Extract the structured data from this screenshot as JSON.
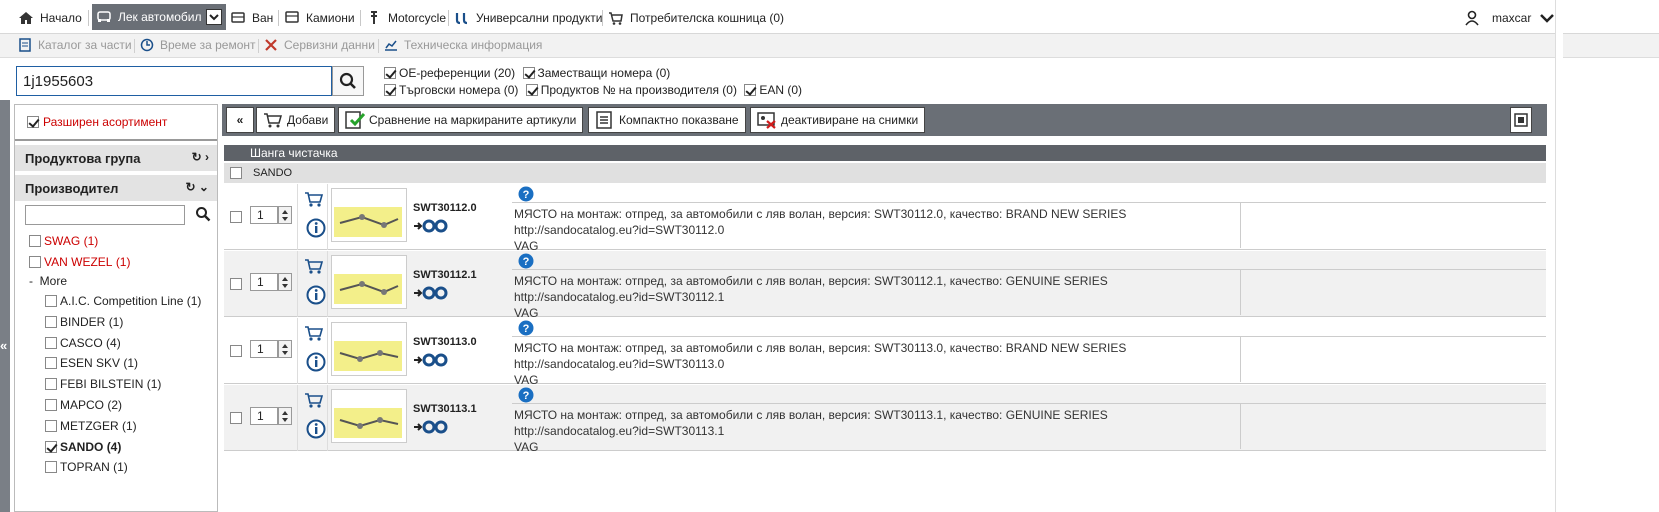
{
  "topnav": {
    "items": [
      {
        "label": "Начало",
        "icon": "home-icon"
      },
      {
        "label": "Лек автомобил",
        "icon": "car-icon",
        "active": true
      },
      {
        "label": "Ван",
        "icon": "van-icon"
      },
      {
        "label": "Камиони",
        "icon": "truck-icon"
      },
      {
        "label": "Motorcycle",
        "icon": "motorcycle-icon"
      },
      {
        "label": "Универсални продукти",
        "icon": "universal-products-icon"
      },
      {
        "label": "Потребителска кошница (0)",
        "icon": "cart-icon"
      }
    ],
    "user": "maxcar"
  },
  "subnav": {
    "items": [
      {
        "label": "Каталог за части",
        "icon": "catalog-icon"
      },
      {
        "label": "Време за ремонт",
        "icon": "clock-icon"
      },
      {
        "label": "Сервизни данни",
        "icon": "tools-icon"
      },
      {
        "label": "Техническа информация",
        "icon": "chart-icon"
      }
    ]
  },
  "search": {
    "value": "1j1955603"
  },
  "filters": [
    {
      "label": "ОЕ-референции (20)",
      "checked": true
    },
    {
      "label": "Заместващи номера (0)",
      "checked": true
    },
    {
      "label": "Търговски номера (0)",
      "checked": true
    },
    {
      "label": "Продуктов № на производителя (0)",
      "checked": true
    },
    {
      "label": "EAN (0)",
      "checked": true
    }
  ],
  "left_panel": {
    "extended": "Разширен асортимент",
    "product_group": "Продуктова група",
    "manufacturer": "Производител",
    "more": "More",
    "manufacturers": [
      {
        "label": "SWAG",
        "count": "(1)",
        "red": true,
        "checked": false
      },
      {
        "label": "VAN WEZEL",
        "count": "(1)",
        "red": true,
        "checked": false
      },
      {
        "label": "A.I.C. Competition Line",
        "count": "(1)",
        "checked": false
      },
      {
        "label": "BINDER",
        "count": "(1)",
        "checked": false
      },
      {
        "label": "CASCO",
        "count": "(4)",
        "checked": false
      },
      {
        "label": "ESEN SKV",
        "count": "(1)",
        "checked": false
      },
      {
        "label": "FEBI BILSTEIN",
        "count": "(1)",
        "checked": false
      },
      {
        "label": "MAPCO",
        "count": "(2)",
        "checked": false
      },
      {
        "label": "METZGER",
        "count": "(1)",
        "checked": false
      },
      {
        "label": "SANDO",
        "count": "(4)",
        "checked": true,
        "bold": true
      },
      {
        "label": "TOPRAN",
        "count": "(1)",
        "checked": false
      }
    ]
  },
  "toolbar": {
    "collapse": "«",
    "add": "Добави",
    "compare": "Сравнение на маркираните артикули",
    "compact": "Компактно показване",
    "images": "деактивиране на снимки"
  },
  "results": {
    "group": "Шанга чистачка",
    "brand": "SANDO",
    "articles": [
      {
        "qty": "1",
        "number": "SWT30112.0",
        "desc": "МЯСТО на монтаж: отпред, за автомобили с ляв волан, версия: SWT30112.0, качество: BRAND NEW SERIES",
        "url": "http://sandocatalog.eu?id=SWT30112.0",
        "brand": "VAG"
      },
      {
        "qty": "1",
        "number": "SWT30112.1",
        "desc": "МЯСТО на монтаж: отпред, за автомобили с ляв волан, версия: SWT30112.1, качество: GENUINE SERIES",
        "url": "http://sandocatalog.eu?id=SWT30112.1",
        "brand": "VAG"
      },
      {
        "qty": "1",
        "number": "SWT30113.0",
        "desc": "МЯСТО на монтаж: отпред, за автомобили с ляв волан, версия: SWT30113.0, качество: BRAND NEW SERIES",
        "url": "http://sandocatalog.eu?id=SWT30113.0",
        "brand": "VAG"
      },
      {
        "qty": "1",
        "number": "SWT30113.1",
        "desc": "МЯСТО на монтаж: отпред, за автомобили с ляв волан, версия: SWT30113.1, качество: GENUINE SERIES",
        "url": "http://sandocatalog.eu?id=SWT30113.1",
        "brand": "VAG"
      }
    ]
  },
  "colors": {
    "toolbar": "#6a6f76",
    "accent_red": "#cc0000",
    "link_blue": "#1a6fc2"
  }
}
